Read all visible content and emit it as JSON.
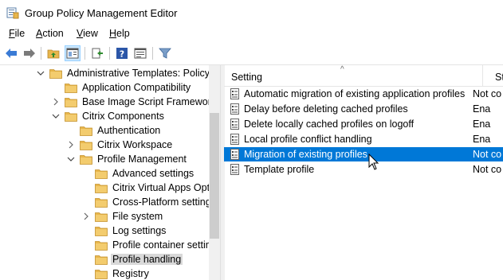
{
  "window": {
    "title": "Group Policy Management Editor"
  },
  "menu": [
    {
      "acc": "F",
      "rest": "ile"
    },
    {
      "acc": "A",
      "rest": "ction"
    },
    {
      "acc": "V",
      "rest": "iew"
    },
    {
      "acc": "H",
      "rest": "elp"
    }
  ],
  "toolbar": [
    "back-icon",
    "forward-icon",
    "up-folder-icon",
    "show-tree-icon",
    "export-icon",
    "help-icon",
    "properties-view-icon",
    "filter-icon"
  ],
  "tree": [
    {
      "label": "Administrative Templates: Policy",
      "expander": "expanded"
    },
    {
      "label": "Application Compatibility",
      "expander": "none"
    },
    {
      "label": "Base Image Script Framework",
      "expander": "collapsed"
    },
    {
      "label": "Citrix Components",
      "expander": "expanded"
    },
    {
      "label": "Authentication",
      "expander": "none"
    },
    {
      "label": "Citrix Workspace",
      "expander": "collapsed"
    },
    {
      "label": "Profile Management",
      "expander": "expanded"
    },
    {
      "label": "Advanced settings",
      "expander": "none"
    },
    {
      "label": "Citrix Virtual Apps Opti",
      "expander": "none"
    },
    {
      "label": "Cross-Platform setting",
      "expander": "none"
    },
    {
      "label": "File system",
      "expander": "collapsed"
    },
    {
      "label": "Log settings",
      "expander": "none"
    },
    {
      "label": "Profile container settin",
      "expander": "none"
    },
    {
      "label": "Profile handling",
      "expander": "none",
      "selected": true
    },
    {
      "label": "Registry",
      "expander": "none"
    }
  ],
  "list": {
    "headers": {
      "setting": "Setting",
      "state": "St"
    },
    "rows": [
      {
        "name": "Automatic migration of existing application profiles",
        "state": "Not co"
      },
      {
        "name": "Delay before deleting cached profiles",
        "state": "Ena"
      },
      {
        "name": "Delete locally cached profiles on logoff",
        "state": "Ena"
      },
      {
        "name": "Local profile conflict handling",
        "state": "Ena"
      },
      {
        "name": "Migration of existing profiles",
        "state": "Not co",
        "selected": true
      },
      {
        "name": "Template profile",
        "state": "Not co"
      }
    ]
  },
  "colors": {
    "selection": "#0078d7",
    "folder": "#e8b64b",
    "tree_selected": "#d9d9d9"
  }
}
